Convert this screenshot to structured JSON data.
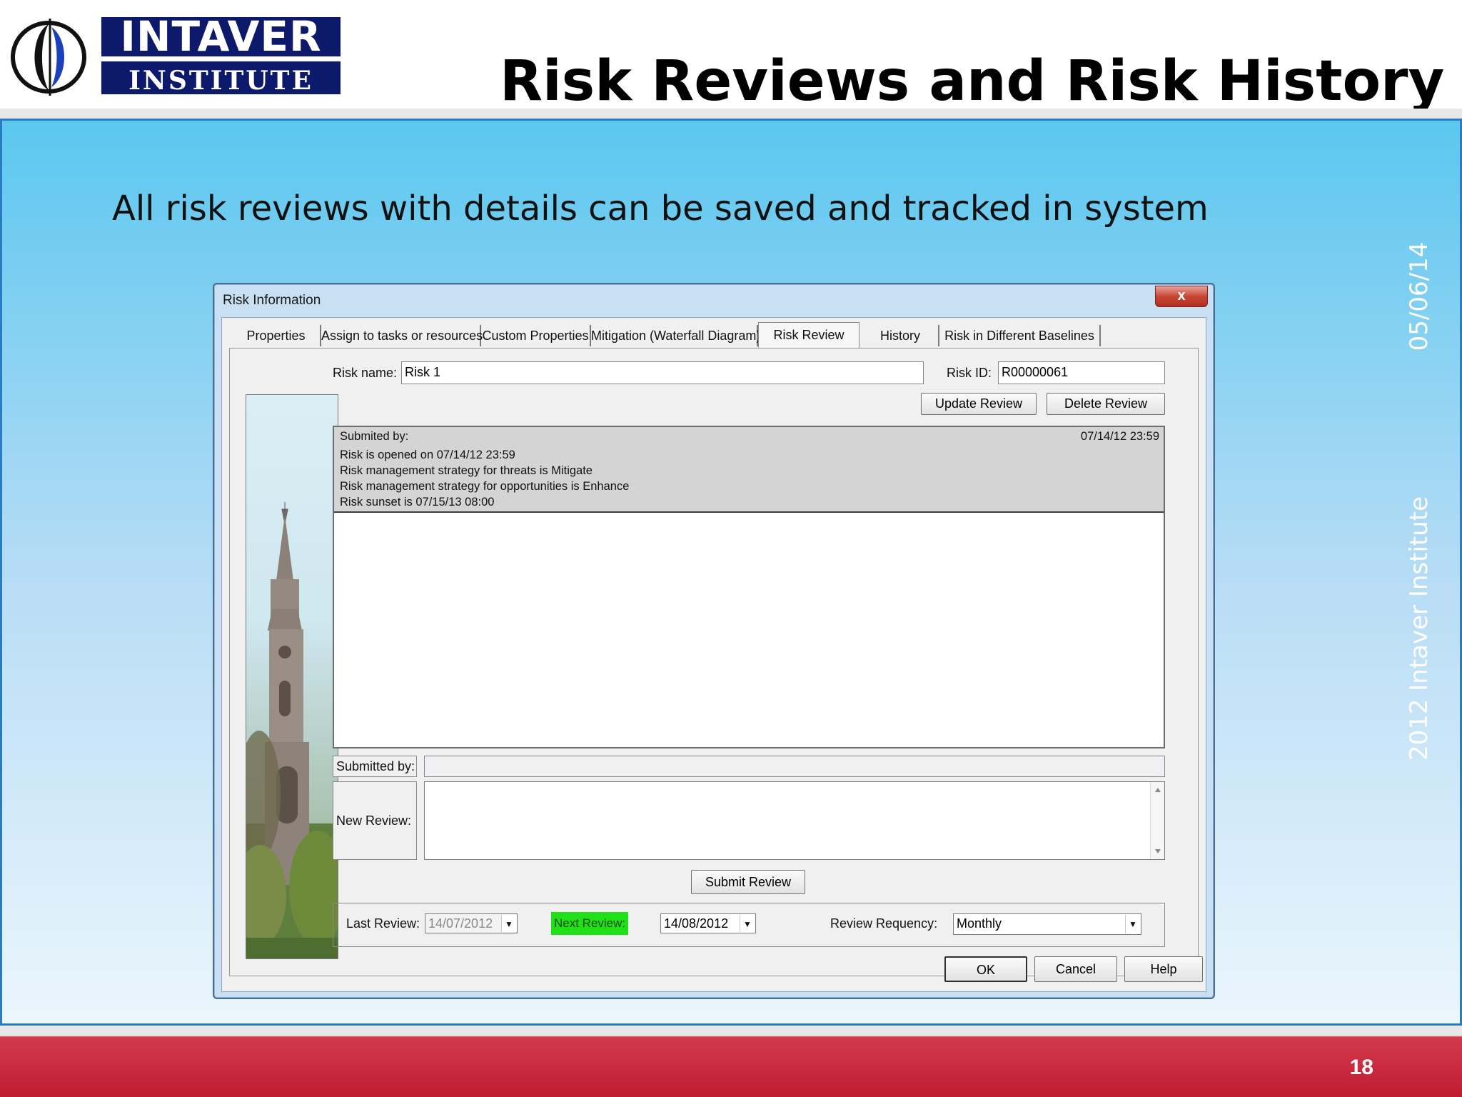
{
  "slide": {
    "logo_top": "INTAVER",
    "logo_bottom": "INSTITUTE",
    "title": "Risk Reviews and Risk History",
    "subtitle": "All risk reviews with details can be saved and tracked in system",
    "side_date": "05/06/14",
    "side_copyright": "2012 Intaver Institute",
    "page_number": "18",
    "colors": {
      "title_bar_top": "#5bc7ef",
      "footer": "#c01c31",
      "logo": "#0d1a6b"
    }
  },
  "dialog": {
    "title": "Risk Information",
    "close_label": "x",
    "tabs": [
      {
        "label": "Properties"
      },
      {
        "label": "Assign to tasks or resources"
      },
      {
        "label": "Custom Properties"
      },
      {
        "label": "Mitigation (Waterfall Diagram)"
      },
      {
        "label": "Risk Review"
      },
      {
        "label": "History"
      },
      {
        "label": "Risk in Different Baselines"
      }
    ],
    "active_tab": "Risk Review",
    "risk_name_label": "Risk name:",
    "risk_name_value": "Risk 1",
    "risk_id_label": "Risk ID:",
    "risk_id_value": "R00000061",
    "update_review_label": "Update Review",
    "delete_review_label": "Delete Review",
    "history": {
      "submitted_by": "Submited by:",
      "date": "07/14/12 23:59",
      "lines": [
        "Risk is opened on 07/14/12 23:59",
        "Risk management strategy for threats is Mitigate",
        "Risk management strategy for opportunities is Enhance",
        "Risk sunset is 07/15/13 08:00"
      ]
    },
    "submitted_by_label": "Submitted by:",
    "submitted_by_value": "",
    "new_review_label": "New Review:",
    "new_review_value": "",
    "submit_review_label": "Submit Review",
    "last_review_label": "Last Review:",
    "last_review_value": "14/07/2012",
    "next_review_label": "Next Review:",
    "next_review_value": "14/08/2012",
    "review_frequency_label": "Review Requency:",
    "review_frequency_value": "Monthly",
    "ok_label": "OK",
    "cancel_label": "Cancel",
    "help_label": "Help"
  }
}
